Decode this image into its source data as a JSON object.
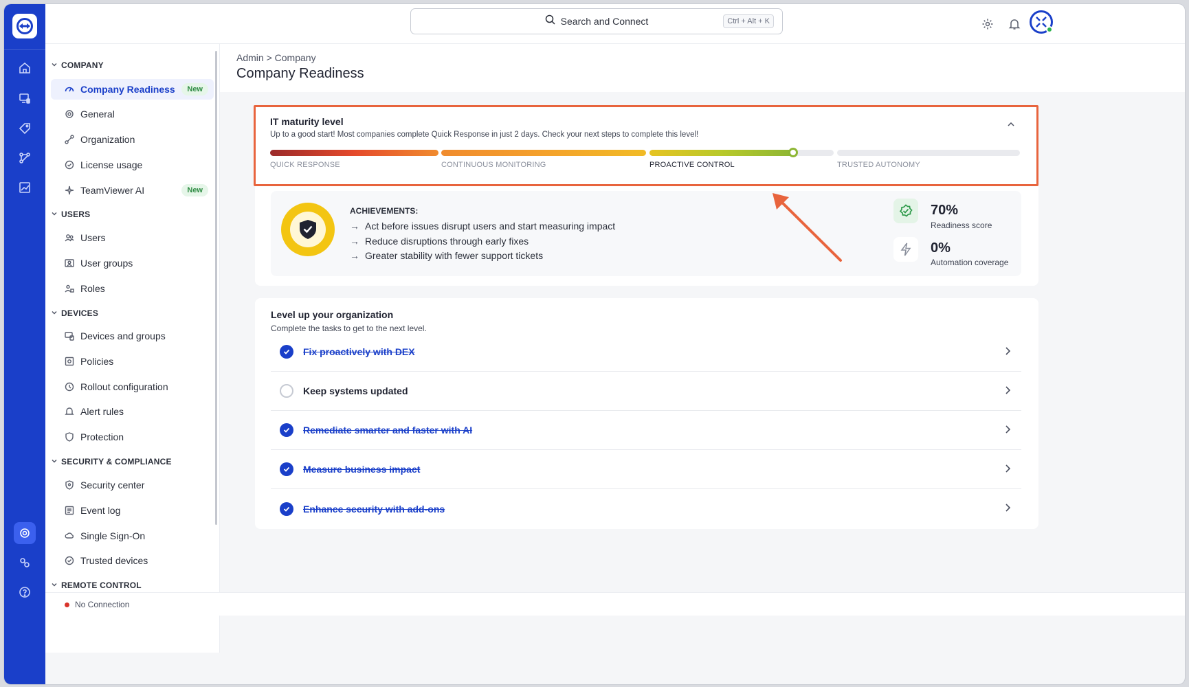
{
  "topbar": {
    "search_label": "Search and Connect",
    "search_shortcut": "Ctrl + Alt + K"
  },
  "sidebar": {
    "sections": {
      "company": "COMPANY",
      "users": "USERS",
      "devices": "DEVICES",
      "security": "SECURITY & COMPLIANCE",
      "remote": "REMOTE CONTROL"
    },
    "items": {
      "company_readiness": "Company Readiness",
      "general": "General",
      "organization": "Organization",
      "license_usage": "License usage",
      "teamviewer_ai": "TeamViewer AI",
      "users": "Users",
      "user_groups": "User groups",
      "roles": "Roles",
      "devices_and_groups": "Devices and groups",
      "policies": "Policies",
      "rollout_configuration": "Rollout configuration",
      "alert_rules": "Alert rules",
      "protection": "Protection",
      "security_center": "Security center",
      "event_log": "Event log",
      "single_sign_on": "Single Sign-On",
      "trusted_devices": "Trusted devices"
    },
    "badge_new": "New"
  },
  "header": {
    "breadcrumb_admin": "Admin",
    "breadcrumb_sep": ">",
    "breadcrumb_company": "Company",
    "title": "Company Readiness"
  },
  "maturity": {
    "title": "IT maturity level",
    "subtitle": "Up to a good start! Most companies complete Quick Response in just 2 days. Check your next steps to complete this level!",
    "stages": [
      "QUICK RESPONSE",
      "CONTINUOUS MONITORING",
      "PROACTIVE CONTROL",
      "TRUSTED AUTONOMY"
    ],
    "current_stage": "PROACTIVE CONTROL",
    "current_stage_progress": 0.78
  },
  "achievements": {
    "label": "ACHIEVEMENTS:",
    "items": [
      "Act before issues disrupt users and start measuring impact",
      "Reduce disruptions through early fixes",
      "Greater stability with fewer support tickets"
    ],
    "arrow": "→"
  },
  "stats": {
    "readiness_value": "70%",
    "readiness_label": "Readiness score",
    "automation_value": "0%",
    "automation_label": "Automation coverage"
  },
  "level_up": {
    "title": "Level up your organization",
    "subtitle": "Complete the tasks to get to the next level.",
    "tasks": [
      {
        "label": "Fix proactively with DEX",
        "done": true
      },
      {
        "label": "Keep systems updated",
        "done": false
      },
      {
        "label": "Remediate smarter and faster with AI",
        "done": true
      },
      {
        "label": "Measure business impact",
        "done": true
      },
      {
        "label": "Enhance security with add-ons",
        "done": true
      }
    ]
  },
  "footer": {
    "connection_status": "No Connection"
  },
  "colors": {
    "brand": "#1a3fc9",
    "highlight": "#e8643d",
    "status_offline": "#d9342b",
    "badge_green": "#2e8b42"
  }
}
